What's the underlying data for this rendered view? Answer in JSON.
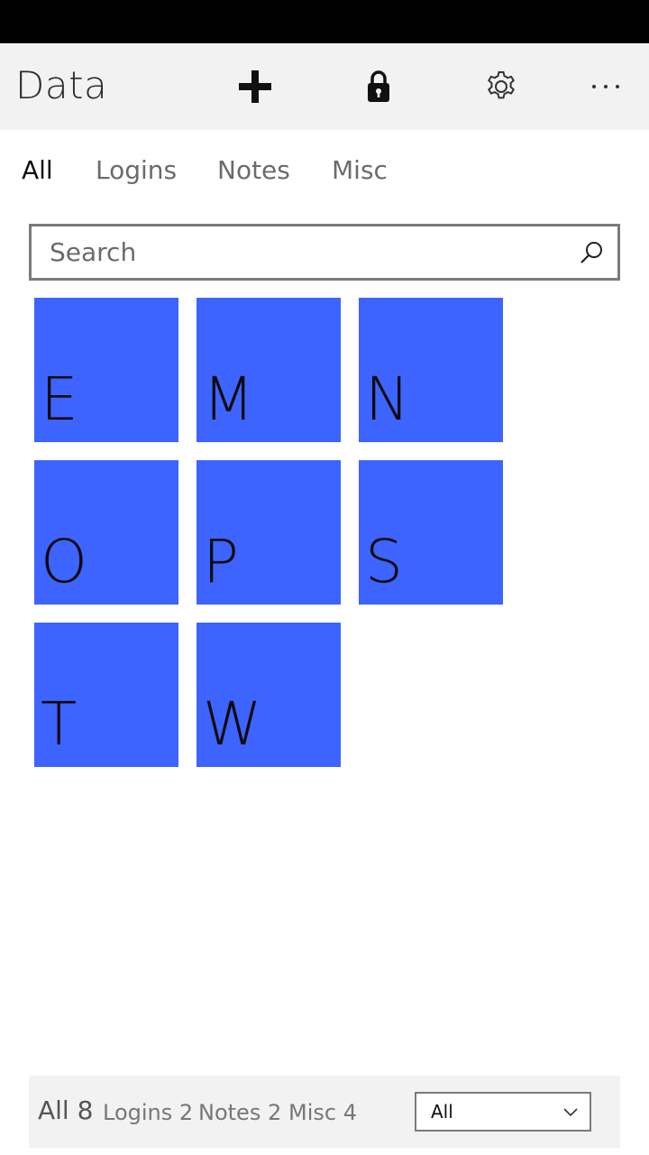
{
  "app_bar": {
    "title": "Data",
    "icons": {
      "add": "plus-icon",
      "lock": "lock-icon",
      "settings": "gear-icon",
      "more": "more-icon"
    }
  },
  "tabs": [
    {
      "label": "All",
      "active": true
    },
    {
      "label": "Logins",
      "active": false
    },
    {
      "label": "Notes",
      "active": false
    },
    {
      "label": "Misc",
      "active": false
    }
  ],
  "search": {
    "placeholder": "Search",
    "value": ""
  },
  "tiles": [
    "E",
    "M",
    "N",
    "O",
    "P",
    "S",
    "T",
    "W"
  ],
  "footer": {
    "counts": {
      "all": "All 8",
      "logins": "Logins 2",
      "notes": "Notes 2",
      "misc": "Misc 4"
    },
    "filter": {
      "selected": "All"
    }
  },
  "colors": {
    "tile": "#3d64ff",
    "app_bar_bg": "#f2f2f2",
    "status_bar": "#000000"
  }
}
